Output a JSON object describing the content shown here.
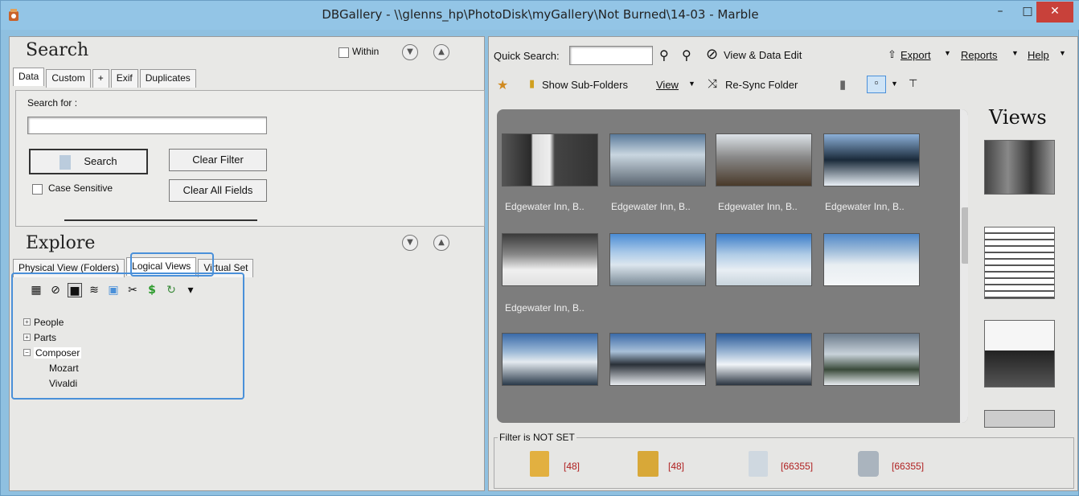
{
  "window": {
    "title": "DBGallery - \\\\glenns_hp\\PhotoDisk\\myGallery\\Not Burned\\14-03 - Marble",
    "minimize": "–",
    "maximize": "□",
    "close": "✕",
    "accent": "#93c5e6"
  },
  "search": {
    "title": "Search",
    "within_label": "Within",
    "tabs": [
      "Data",
      "Custom",
      "+",
      "Exif",
      "Duplicates"
    ],
    "search_for_label": "Search for :",
    "search_value": "",
    "search_button": "Search",
    "clear_filter_button": "Clear Filter",
    "case_sensitive_label": "Case Sensitive",
    "clear_all_button": "Clear All Fields"
  },
  "explore": {
    "title": "Explore",
    "tabs": [
      "Physical View (Folders)",
      "Logical Views",
      "Virtual Set"
    ],
    "tree": [
      {
        "label": "People",
        "expander": "+"
      },
      {
        "label": "Parts",
        "expander": "+"
      },
      {
        "label": "Composer",
        "expander": "−"
      },
      {
        "label": "Mozart",
        "expander": ""
      },
      {
        "label": "Vivaldi",
        "expander": ""
      }
    ]
  },
  "toolbar": {
    "quick_search_label": "Quick Search:",
    "quick_search_value": "",
    "view_data_edit": "View & Data Edit",
    "export": "Export",
    "reports": "Reports",
    "help": "Help",
    "show_sub_folders": "Show Sub-Folders",
    "view": "View",
    "resync": "Re-Sync Folder"
  },
  "gallery": {
    "captions": [
      "Edgewater Inn, B..",
      "Edgewater Inn, B..",
      "Edgewater Inn, B..",
      "Edgewater Inn, B..",
      "Edgewater Inn, B.."
    ]
  },
  "views": {
    "title": "Views"
  },
  "filter": {
    "label": "Filter is NOT SET",
    "counts": [
      "[48]",
      "[48]",
      "[66355]",
      "[66355]"
    ]
  }
}
